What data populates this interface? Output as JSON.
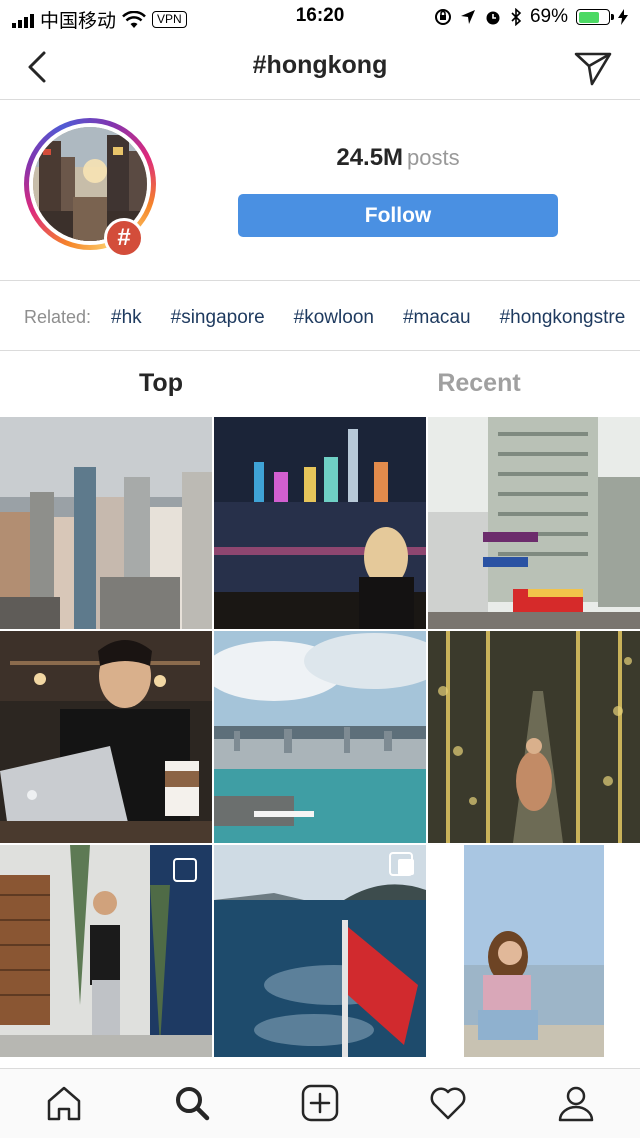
{
  "status_bar": {
    "carrier": "中国移动",
    "vpn": "VPN",
    "time": "16:20",
    "battery": "69%",
    "battery_level": 0.69
  },
  "header": {
    "title": "#hongkong",
    "back_icon": "chevron-left-icon",
    "send_icon": "paper-plane-icon"
  },
  "profile": {
    "posts_count": "24.5M",
    "posts_label": "posts",
    "badge_symbol": "#",
    "follow_label": "Follow"
  },
  "related": {
    "label": "Related:",
    "tags": [
      "#hk",
      "#singapore",
      "#kowloon",
      "#macau",
      "#hongkongstre"
    ]
  },
  "tabs": {
    "top": "Top",
    "recent": "Recent"
  },
  "grid": [
    {
      "desc": "city skyline buildings"
    },
    {
      "desc": "victoria harbour at night with woman"
    },
    {
      "desc": "old apartment building with street signs and bus"
    },
    {
      "desc": "man working on laptop in cafe"
    },
    {
      "desc": "harbour aerial view with clouds"
    },
    {
      "desc": "woman walking in mirrored light corridor"
    },
    {
      "desc": "woman posing by cactus wall"
    },
    {
      "desc": "sea view from ferry with red flag"
    },
    {
      "desc": "girl sitting by the sea"
    }
  ],
  "colors": {
    "accent": "#4a90e2",
    "badge": "#d34d3a",
    "related_tag": "#1e3a5f"
  },
  "tab_bar": {
    "icons": [
      "home-icon",
      "search-icon",
      "add-post-icon",
      "heart-icon",
      "profile-icon"
    ]
  }
}
